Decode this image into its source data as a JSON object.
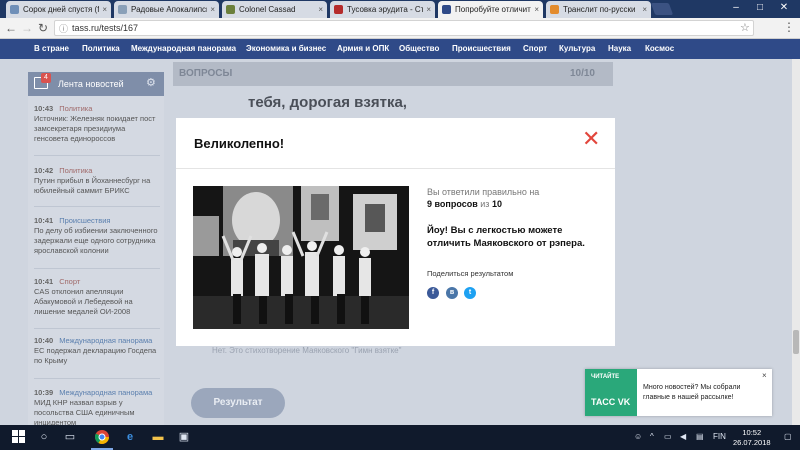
{
  "browser": {
    "tabs": [
      {
        "title": "Сорок дней спустя (fbs",
        "favicon_color": "#6f8fb8"
      },
      {
        "title": "Радовые Апокалипсис",
        "favicon_color": "#8aa0b8"
      },
      {
        "title": "Colonel Cassad",
        "favicon_color": "#6b7f3b"
      },
      {
        "title": "Тусовка эрудита - Стра",
        "favicon_color": "#b52b2b"
      },
      {
        "title": "Попробуйте отличить",
        "favicon_color": "#2f4a88"
      },
      {
        "title": "Транслит по-русски",
        "favicon_color": "#e38b2c"
      }
    ],
    "close_glyph": "×",
    "url": "tass.ru/tests/167",
    "window_controls": {
      "minimize": "–",
      "maximize": "□",
      "close": "✕"
    }
  },
  "site_nav": {
    "items": [
      "В стране",
      "Политика",
      "Международная панорама",
      "Экономика и бизнес",
      "Армия и ОПК",
      "Общество",
      "Происшествия",
      "Спорт",
      "Культура",
      "Наука",
      "Космос"
    ]
  },
  "news_feed": {
    "title": "Лента новостей",
    "badge": "4",
    "items": [
      {
        "time": "10:43",
        "category": "Политика",
        "text": "Источник: Железняк покидает пост замсекретаря президиума генсовета единороссов"
      },
      {
        "time": "10:42",
        "category": "Политика",
        "text": "Путин прибыл в Йоханнесбург на юбилейный саммит БРИКС"
      },
      {
        "time": "10:41",
        "category": "Происшествия",
        "text": "По делу об избиении заключенного задержали еще одного сотрудника ярославской колонии"
      },
      {
        "time": "10:41",
        "category": "Спорт",
        "text": "CAS отклонил апелляции Абакумовой и Лебедевой на лишение медалей ОИ-2008"
      },
      {
        "time": "10:40",
        "category": "Международная панорама",
        "text": "ЕС подержал декларацию Госдепа по Крыму"
      },
      {
        "time": "10:39",
        "category": "Международная панорама",
        "text": "МИД КНР назвал взрыв у посольства США единичным инцидентом"
      }
    ]
  },
  "quiz": {
    "header": "ВОПРОСЫ",
    "counter": "10/10",
    "question_fragment": "тебя, дорогая взятка,",
    "answer_note": "Нет. Это стихотворение Маяковского \"Гимн взятке\"",
    "result_button": "Результат"
  },
  "modal": {
    "title": "Великолепно!",
    "close_glyph": "✕",
    "score_prefix": "Вы ответили правильно на",
    "score_value": "9 вопросов",
    "score_of": "из",
    "score_total": "10",
    "verdict": "Йоу! Вы с легкостью можете отличить Маяковского от рэпера.",
    "share_label": "Поделиться результатом",
    "social": [
      {
        "letter": "f",
        "color": "#3b5998"
      },
      {
        "letter": "в",
        "color": "#4a76a8"
      },
      {
        "letter": "t",
        "color": "#1da1f2"
      }
    ]
  },
  "toast": {
    "label": "ЧИТАЙТЕ",
    "brand": "ТАСС VK",
    "message": "Много новостей? Мы собрали главные в нашей рассылке!",
    "close_glyph": "×"
  },
  "taskbar": {
    "lang": "FIN",
    "time": "10:52",
    "date": "26.07.2018"
  }
}
